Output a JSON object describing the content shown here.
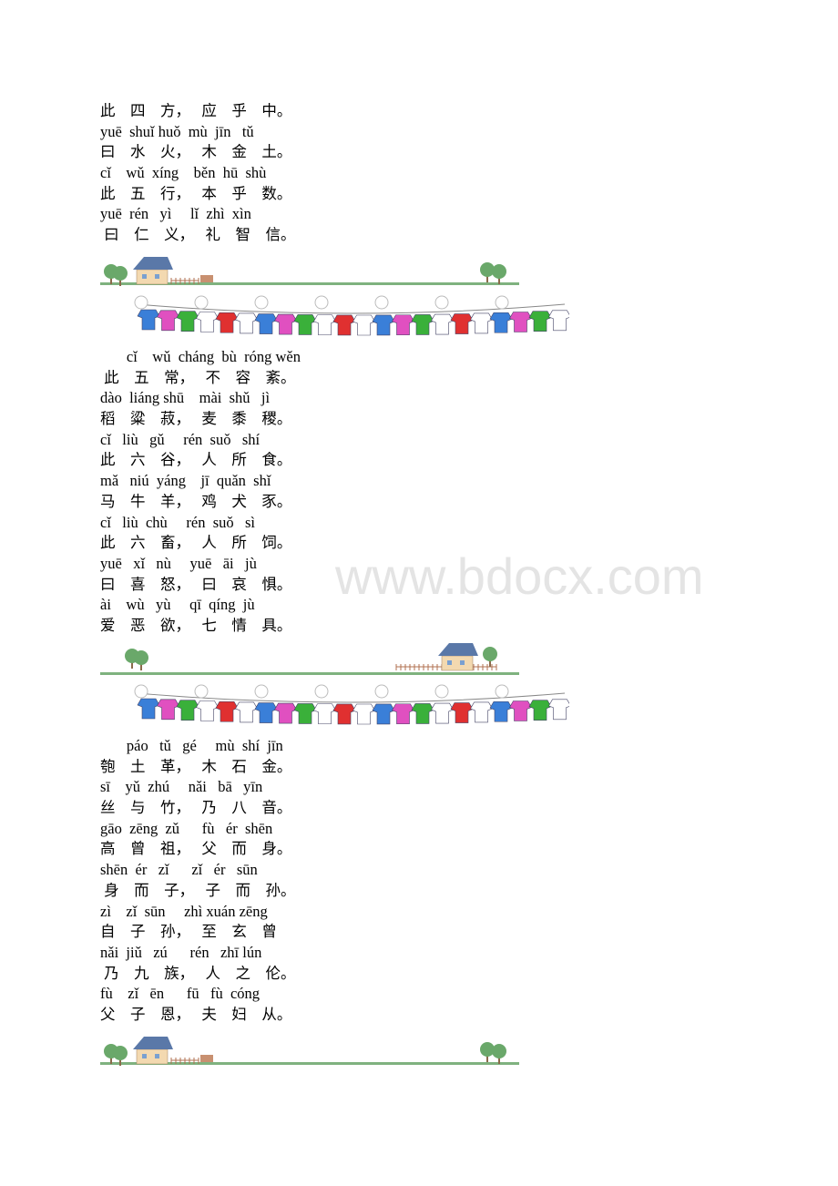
{
  "sections": [
    {
      "lines": [
        "此    四    方，   应    乎    中。",
        "yuē  shuǐ huǒ  mù  jīn   tǔ",
        "曰    水    火，   木    金    土。",
        "cǐ    wǔ  xíng    běn  hū  shù",
        "此    五    行，   本    乎    数。",
        "yuē  rén   yì     lǐ  zhì  xìn",
        " 曰    仁    义，   礼    智    信。"
      ]
    },
    {
      "lines": [
        "       cǐ    wǔ  cháng  bù  róng wěn",
        " 此    五    常，   不    容    紊。",
        "dào  liáng shū    mài  shǔ   jì",
        "稻    粱    菽，   麦    黍    稷。",
        "cǐ   liù   gǔ     rén  suǒ   shí",
        "此    六    谷，   人    所    食。",
        "mǎ   niú  yáng    jī  quǎn  shǐ",
        "马    牛    羊，   鸡    犬    豕。",
        "cǐ   liù  chù     rén  suǒ   sì",
        "此    六    畜，   人    所    饲。",
        "yuē   xǐ   nù     yuē   āi   jù",
        "曰    喜    怒，   曰    哀    惧。",
        "ài    wù   yù     qī  qíng  jù",
        "爱    恶    欲，   七    情    具。"
      ]
    },
    {
      "lines": [
        "       páo   tǔ   gé     mù  shí  jīn",
        "匏    土    革，   木    石    金。",
        "sī    yǔ  zhú     nǎi   bā   yīn",
        "丝    与    竹，   乃    八    音。",
        "gāo  zēng  zǔ      fù   ér  shēn",
        "高    曾    祖，   父    而    身。",
        "shēn  ér   zǐ      zǐ   ér   sūn",
        " 身    而    子，   子    而    孙。",
        "zì    zǐ  sūn     zhì xuán zēng",
        "自    子    孙，   至    玄    曾",
        "nǎi  jiǔ   zú      rén   zhī lún",
        " 乃    九    族，   人    之    伦。",
        "fù    zǐ   ēn      fū   fù  cóng",
        "父    子    恩，   夫    妇    从。"
      ]
    }
  ],
  "watermark": "www.bdocx.com",
  "colors": {
    "grass": "#7fb27f",
    "roof": "#5a78a8",
    "wall": "#f3d9b0",
    "tree": "#6aa86a",
    "watermark": "#e4e4e4"
  }
}
